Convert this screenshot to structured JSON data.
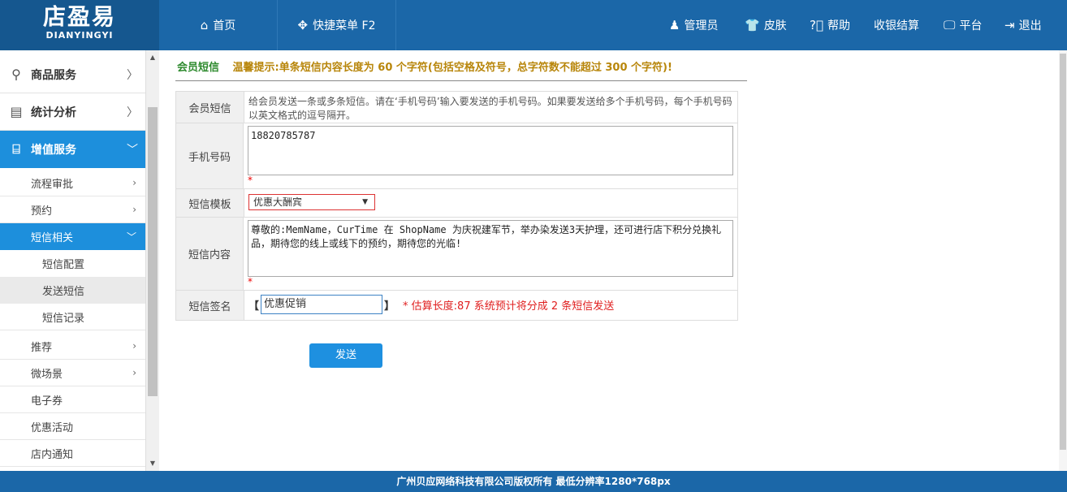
{
  "header": {
    "logo_main": "店盈易",
    "logo_sub": "DIANYINGYI",
    "nav_home": "首页",
    "nav_quick": "快捷菜单 F2",
    "right": {
      "admin": "管理员",
      "skin": "皮肤",
      "help": "帮助",
      "checkout": "收银结算",
      "platform": "平台",
      "logout": "退出"
    }
  },
  "sidebar": {
    "l1": [
      {
        "label": "商品服务",
        "icon": "tags-icon"
      },
      {
        "label": "统计分析",
        "icon": "chart-icon"
      },
      {
        "label": "增值服务",
        "icon": "map-icon"
      }
    ],
    "l2": {
      "process": "流程审批",
      "booking": "预约",
      "sms": "短信相关",
      "recommend": "推荐",
      "micro": "微场景",
      "coupon": "电子券",
      "promo": "优惠活动",
      "notice": "店内通知"
    },
    "l3": {
      "config": "短信配置",
      "send": "发送短信",
      "records": "短信记录"
    }
  },
  "breadcrumb": {
    "title": "会员短信",
    "tip": "温馨提示:单条短信内容长度为 60 个字符(包括空格及符号，总字符数不能超过 300 个字符)!"
  },
  "form": {
    "row1": {
      "label": "会员短信",
      "desc": "给会员发送一条或多条短信。请在‘手机号码’输入要发送的手机号码。如果要发送给多个手机号码，每个手机号码以英文格式的逗号隔开。"
    },
    "row2": {
      "label": "手机号码",
      "value": "18820785787"
    },
    "row3": {
      "label": "短信模板",
      "selected": "优惠大酬宾"
    },
    "row4": {
      "label": "短信内容",
      "value": "尊敬的:MemName，CurTime 在 ShopName 为庆祝建军节，举办染发送3天护理，还可进行店下积分兑换礼品，期待您的线上或线下的预约，期待您的光临!"
    },
    "row5": {
      "label": "短信签名",
      "bracket_left": "【",
      "value": "优惠促销",
      "bracket_right": "】",
      "note": "* 估算长度:87 系统预计将分成 2 条短信发送"
    },
    "required_mark": "*",
    "send_label": "发送"
  },
  "footer": {
    "text": "广州贝应网络科技有限公司版权所有 最低分辨率1280*768px"
  }
}
